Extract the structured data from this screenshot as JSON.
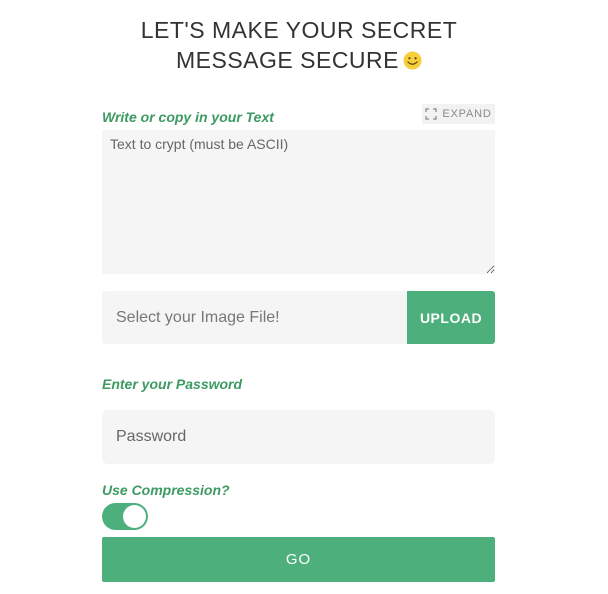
{
  "header": {
    "title_line1": "LET'S MAKE YOUR SECRET",
    "title_line2": "MESSAGE SECURE",
    "emoji_icon": "smiley-face-icon"
  },
  "text_section": {
    "label": "Write or copy in your Text",
    "expand_label": "EXPAND",
    "expand_icon": "expand-arrows-icon",
    "textarea_placeholder": "Text to crypt (must be ASCII)",
    "textarea_value": ""
  },
  "file_section": {
    "placeholder": "Select your Image File!",
    "upload_label": "UPLOAD"
  },
  "password_section": {
    "label": "Enter your Password",
    "placeholder": "Password",
    "value": ""
  },
  "compression_section": {
    "label": "Use Compression?",
    "enabled": true
  },
  "submit": {
    "label": "GO"
  },
  "colors": {
    "accent": "#4daf7c",
    "label_green": "#3d9a62",
    "field_bg": "#f5f5f5",
    "title_text": "#333333"
  }
}
